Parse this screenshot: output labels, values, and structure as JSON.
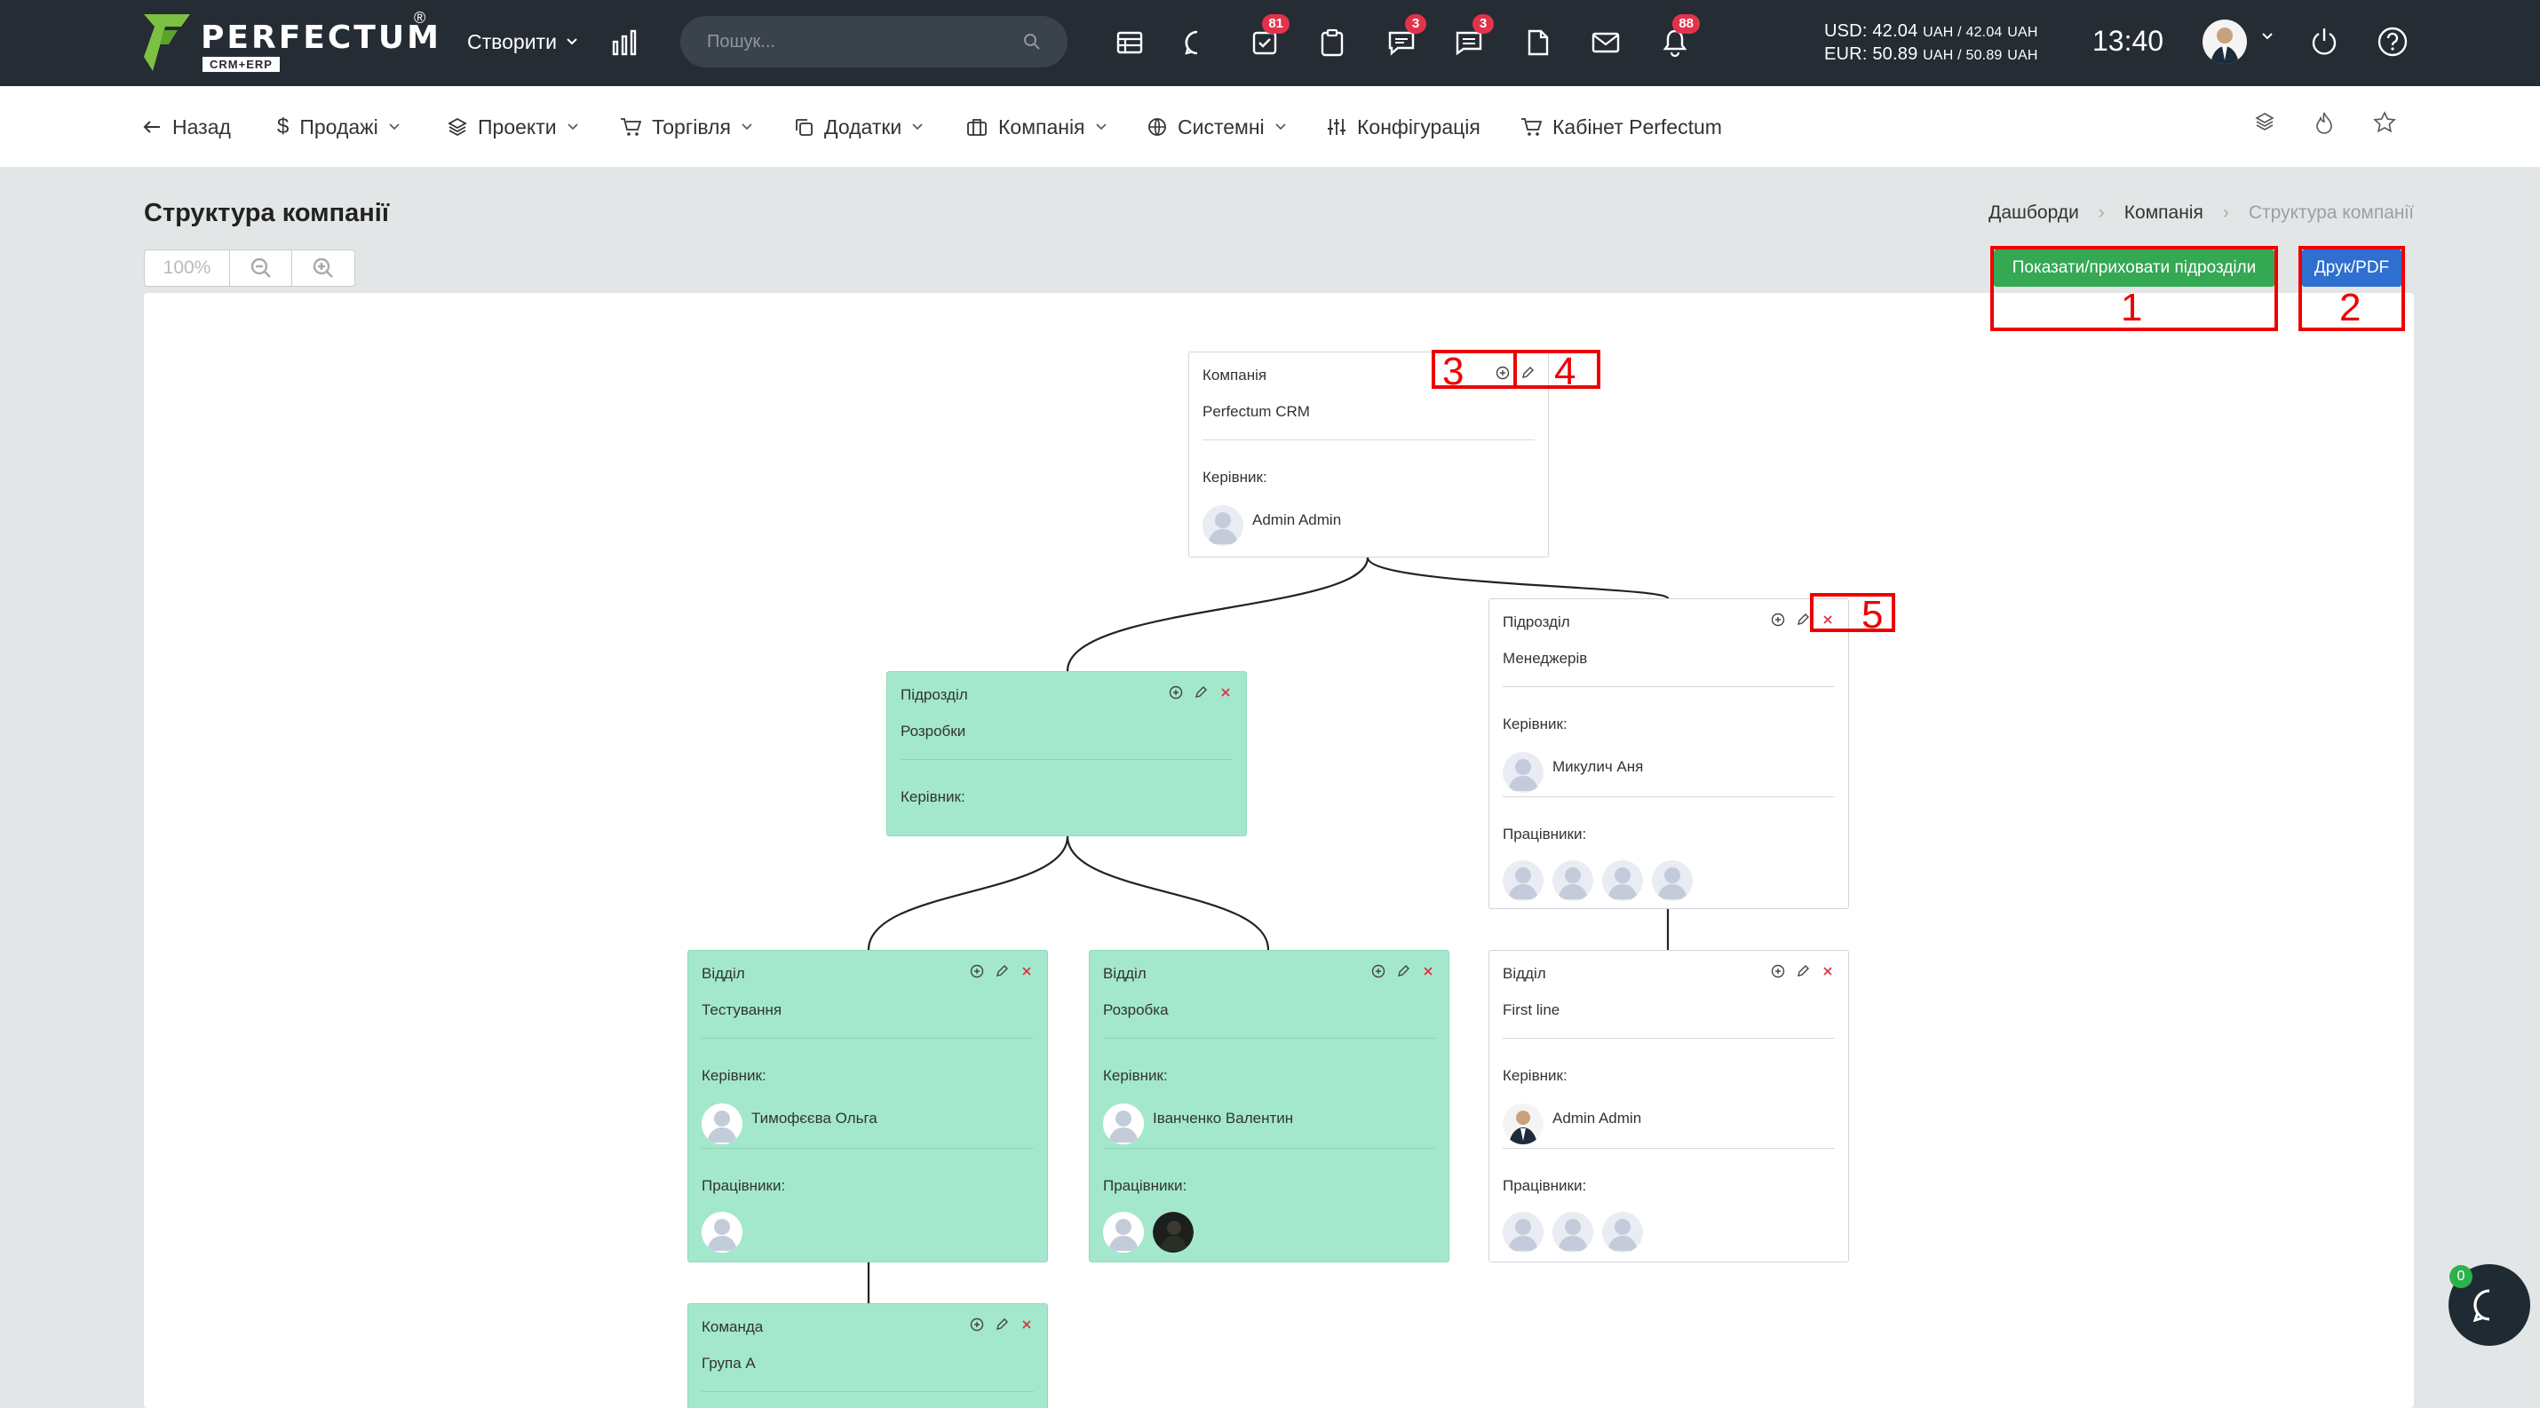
{
  "brand": {
    "name": "PERFECTUM",
    "sub": "CRM+ERP",
    "reg": "®"
  },
  "topbar": {
    "create_label": "Створити",
    "search_placeholder": "Пошук...",
    "badges": {
      "tasks": "81",
      "chat": "3",
      "messages": "3",
      "notifications": "88"
    },
    "rates_usd": "USD: 42.04",
    "rates_usd_tail": "UAH / 42.04",
    "rates_eur": "EUR: 50.89",
    "rates_eur_tail": "UAH / 50.89",
    "uah": "UAH",
    "time": "13:40"
  },
  "nav": {
    "back": "Назад",
    "sales": "Продажі",
    "projects": "Проекти",
    "trade": "Торгівля",
    "addons": "Додатки",
    "company": "Компанія",
    "system": "Системні",
    "config": "Конфігурація",
    "cabinet": "Кабінет Perfectum"
  },
  "page": {
    "title": "Структура компанії",
    "breadcrumbs": [
      "Дашборди",
      "Компанія",
      "Структура компанії"
    ],
    "zoom_level": "100%",
    "show_hide_label": "Показати/приховати підрозділи",
    "print_label": "Друк/PDF"
  },
  "annotations": [
    "1",
    "2",
    "3",
    "4",
    "5"
  ],
  "labels": {
    "manager": "Керівник:",
    "employees": "Працівники:"
  },
  "nodes": {
    "company": {
      "type": "Компанія",
      "name": "Perfectum CRM",
      "manager": "Admin Admin"
    },
    "div_dev": {
      "type": "Підрозділ",
      "name": "Розробки"
    },
    "div_mgr": {
      "type": "Підрозділ",
      "name": "Менеджерів",
      "manager": "Микулич Аня",
      "employees_count": 4
    },
    "dep_test": {
      "type": "Відділ",
      "name": "Тестування",
      "manager": "Тимофєєва Ольга",
      "employees_count": 1
    },
    "dep_dev": {
      "type": "Відділ",
      "name": "Розробка",
      "manager": "Іванченко Валентин",
      "employees_count": 2
    },
    "dep_first": {
      "type": "Відділ",
      "name": "First line",
      "manager": "Admin Admin",
      "employees_count": 3
    },
    "team_a": {
      "type": "Команда",
      "name": "Група А"
    }
  },
  "chat": {
    "count": "0"
  },
  "colors": {
    "topbar": "#252c34",
    "node_green": "#a3e8cc",
    "show_btn": "#34a853",
    "print_btn": "#2e6fd0",
    "annotation": "#e00000",
    "badge": "#e2334a"
  }
}
